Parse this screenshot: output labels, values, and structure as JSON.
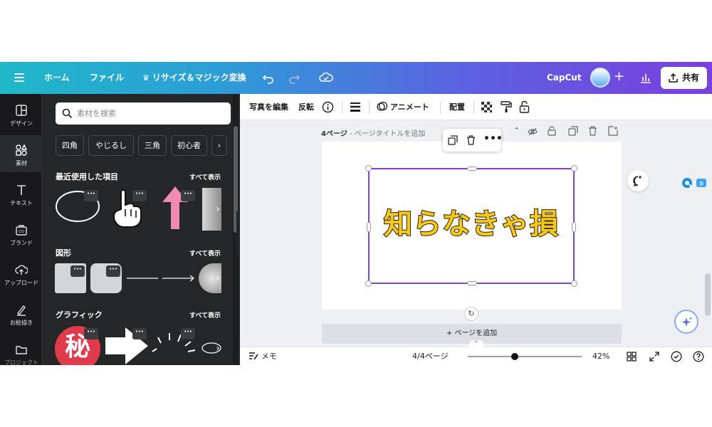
{
  "topbar": {
    "home": "ホーム",
    "file": "ファイル",
    "resize": "リサイズ＆マジック変換",
    "brand_text": "CapCut",
    "plus": "+",
    "share": "共有",
    "icons": [
      "menu-icon",
      "undo-icon",
      "redo-icon",
      "cloud-check-icon",
      "chart-icon",
      "upload-icon"
    ]
  },
  "rail": {
    "items": [
      {
        "label": "デザイン",
        "icon": "layout-icon"
      },
      {
        "label": "素材",
        "icon": "elements-icon"
      },
      {
        "label": "テキスト",
        "icon": "text-icon"
      },
      {
        "label": "ブランド",
        "icon": "brand-icon"
      },
      {
        "label": "アップロード",
        "icon": "upload-cloud-icon"
      },
      {
        "label": "お絵描き",
        "icon": "draw-icon"
      },
      {
        "label": "プロジェクト",
        "icon": "folder-icon"
      }
    ]
  },
  "panel": {
    "search_placeholder": "素材を検索",
    "chips": [
      "四角",
      "やじるし",
      "三角",
      "初心者"
    ],
    "sections": [
      {
        "title": "最近使用した項目",
        "see_all": "すべて表示"
      },
      {
        "title": "図形",
        "see_all": "すべて表示"
      },
      {
        "title": "グラフィック",
        "see_all": "すべて表示"
      }
    ],
    "graphic_char": "秘",
    "dots": "···"
  },
  "context_toolbar": {
    "edit_photo": "写真を編集",
    "flip": "反転",
    "animate": "アニメート",
    "position": "配置"
  },
  "canvas": {
    "page_prefix": "4ページ",
    "page_title_placeholder": " - ページタイトルを追加",
    "text": "知らなきゃ損",
    "add_page": "+ ページを追加",
    "text_color": "#f7c71b",
    "selection_color": "#8b3fd9"
  },
  "bottom": {
    "memo": "メモ",
    "pages": "4/4ページ",
    "zoom": "42%",
    "zoom_level": 0.42
  },
  "colors": {
    "accent": "#7a3fe0",
    "panel_bg": "#252627",
    "rail_bg": "#19191b"
  }
}
